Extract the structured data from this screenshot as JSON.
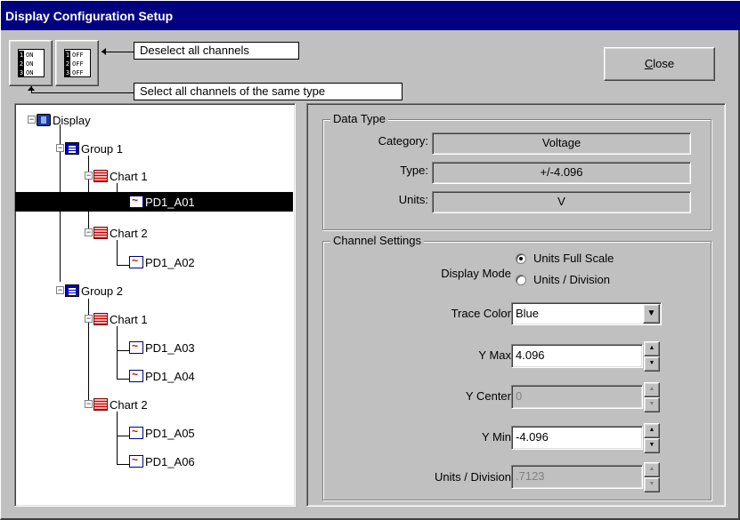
{
  "window": {
    "title": "Display Configuration Setup"
  },
  "toolbar": {
    "select_all_icon": "channels-on-icon",
    "deselect_all_icon": "channels-off-icon",
    "icon_on_rows": [
      {
        "n": "1",
        "t": "ON"
      },
      {
        "n": "2",
        "t": "ON"
      },
      {
        "n": "3",
        "t": "ON"
      }
    ],
    "icon_off_rows": [
      {
        "n": "1",
        "t": "OFF"
      },
      {
        "n": "2",
        "t": "OFF"
      },
      {
        "n": "3",
        "t": "OFF"
      }
    ],
    "tooltip_deselect": "Deselect all channels",
    "tooltip_select_type": "Select all channels of the same type",
    "close_label_accel": "C",
    "close_label_rest": "lose"
  },
  "tree": {
    "root": "Display",
    "group1": "Group 1",
    "group1_chart1": "Chart 1",
    "ch_a01": "PD1_A01",
    "group1_chart2": "Chart 2",
    "ch_a02": "PD1_A02",
    "group2": "Group 2",
    "group2_chart1": "Chart 1",
    "ch_a03": "PD1_A03",
    "ch_a04": "PD1_A04",
    "group2_chart2": "Chart 2",
    "ch_a05": "PD1_A05",
    "ch_a06": "PD1_A06",
    "selected": "PD1_A01"
  },
  "data_type": {
    "title": "Data Type",
    "category_label": "Category:",
    "category_value": "Voltage",
    "type_label": "Type:",
    "type_value": "+/-4.096",
    "units_label": "Units:",
    "units_value": "V"
  },
  "channel_settings": {
    "title": "Channel Settings",
    "display_mode_label": "Display Mode",
    "mode_full_scale": "Units Full Scale",
    "mode_division": "Units / Division",
    "selected_mode": "Units Full Scale",
    "trace_color_label": "Trace Color",
    "trace_color_value": "Blue",
    "ymax_label": "Y Max",
    "ymax_value": "4.096",
    "ycenter_label": "Y Center",
    "ycenter_value": "0",
    "ymin_label": "Y Min",
    "ymin_value": "-4.096",
    "units_div_label": "Units / Division",
    "units_div_value": ".7123"
  }
}
